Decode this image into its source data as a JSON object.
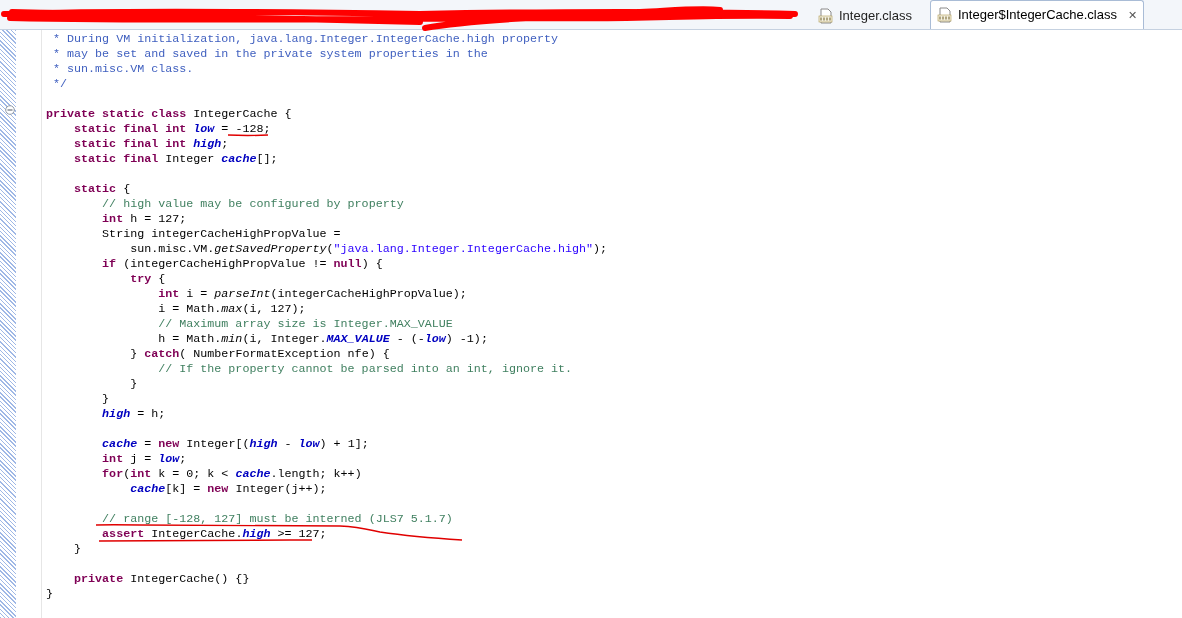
{
  "tabs": [
    {
      "label": "Integer.class",
      "selected": false
    },
    {
      "label": "Integer$IntegerCache.class",
      "selected": true
    }
  ],
  "close_glyph": "✕",
  "editor": {
    "lines": [
      {
        "tokens": [
          {
            "kind": "doc",
            "text": " * During VM initialization, java.lang.Integer.IntegerCache.high property"
          }
        ]
      },
      {
        "tokens": [
          {
            "kind": "doc",
            "text": " * may be set and saved in the private system properties in the"
          }
        ]
      },
      {
        "tokens": [
          {
            "kind": "doc",
            "text": " * sun.misc.VM class."
          }
        ]
      },
      {
        "blank_line_after": true,
        "tokens": [
          {
            "kind": "doc",
            "text": " */"
          }
        ]
      },
      {
        "folded": false,
        "tokens": [
          {
            "kind": "keyword",
            "text": "private static class"
          },
          {
            "kind": "plain",
            "text": " IntegerCache {"
          }
        ]
      },
      {
        "tokens": [
          {
            "kind": "keyword",
            "text": "    static final int "
          },
          {
            "kind": "field",
            "text": "low"
          },
          {
            "kind": "plain",
            "text": " = -128;"
          }
        ]
      },
      {
        "tokens": [
          {
            "kind": "keyword",
            "text": "    static final int "
          },
          {
            "kind": "field",
            "text": "high"
          },
          {
            "kind": "plain",
            "text": ";"
          }
        ]
      },
      {
        "blank_line_after": true,
        "tokens": [
          {
            "kind": "keyword",
            "text": "    static final"
          },
          {
            "kind": "plain",
            "text": " Integer "
          },
          {
            "kind": "field",
            "text": "cache"
          },
          {
            "kind": "plain",
            "text": "[];"
          }
        ]
      },
      {
        "tokens": [
          {
            "kind": "keyword",
            "text": "    static"
          },
          {
            "kind": "plain",
            "text": " {"
          }
        ]
      },
      {
        "tokens": [
          {
            "kind": "comment",
            "text": "        // high value may be configured by property"
          }
        ]
      },
      {
        "tokens": [
          {
            "kind": "keyword",
            "text": "        int"
          },
          {
            "kind": "plain",
            "text": " h = 127;"
          }
        ]
      },
      {
        "tokens": [
          {
            "kind": "plain",
            "text": "        String integerCacheHighPropValue ="
          }
        ]
      },
      {
        "tokens": [
          {
            "kind": "plain",
            "text": "            sun.misc.VM."
          },
          {
            "kind": "static-method",
            "text": "getSavedProperty"
          },
          {
            "kind": "plain",
            "text": "("
          },
          {
            "kind": "string",
            "text": "\"java.lang.Integer.IntegerCache.high\""
          },
          {
            "kind": "plain",
            "text": ");"
          }
        ]
      },
      {
        "tokens": [
          {
            "kind": "keyword",
            "text": "        if"
          },
          {
            "kind": "plain",
            "text": " (integerCacheHighPropValue != "
          },
          {
            "kind": "keyword",
            "text": "null"
          },
          {
            "kind": "plain",
            "text": ") {"
          }
        ]
      },
      {
        "tokens": [
          {
            "kind": "keyword",
            "text": "            try"
          },
          {
            "kind": "plain",
            "text": " {"
          }
        ]
      },
      {
        "tokens": [
          {
            "kind": "keyword",
            "text": "                int"
          },
          {
            "kind": "plain",
            "text": " i = "
          },
          {
            "kind": "static-method",
            "text": "parseInt"
          },
          {
            "kind": "plain",
            "text": "(integerCacheHighPropValue);"
          }
        ]
      },
      {
        "tokens": [
          {
            "kind": "plain",
            "text": "                i = Math."
          },
          {
            "kind": "static-method",
            "text": "max"
          },
          {
            "kind": "plain",
            "text": "(i, 127);"
          }
        ]
      },
      {
        "tokens": [
          {
            "kind": "comment",
            "text": "                // Maximum array size is Integer.MAX_VALUE"
          }
        ]
      },
      {
        "tokens": [
          {
            "kind": "plain",
            "text": "                h = Math."
          },
          {
            "kind": "static-method",
            "text": "min"
          },
          {
            "kind": "plain",
            "text": "(i, Integer."
          },
          {
            "kind": "field",
            "text": "MAX_VALUE"
          },
          {
            "kind": "plain",
            "text": " - (-"
          },
          {
            "kind": "field",
            "text": "low"
          },
          {
            "kind": "plain",
            "text": ") -1);"
          }
        ]
      },
      {
        "tokens": [
          {
            "kind": "plain",
            "text": "            } "
          },
          {
            "kind": "keyword",
            "text": "catch"
          },
          {
            "kind": "plain",
            "text": "( NumberFormatException nfe) {"
          }
        ]
      },
      {
        "tokens": [
          {
            "kind": "comment",
            "text": "                // If the property cannot be parsed into an int, ignore it."
          }
        ]
      },
      {
        "tokens": [
          {
            "kind": "plain",
            "text": "            }"
          }
        ]
      },
      {
        "tokens": [
          {
            "kind": "plain",
            "text": "        }"
          }
        ]
      },
      {
        "blank_line_after": true,
        "tokens": [
          {
            "kind": "field",
            "text": "        high"
          },
          {
            "kind": "plain",
            "text": " = h;"
          }
        ]
      },
      {
        "tokens": [
          {
            "kind": "field",
            "text": "        cache"
          },
          {
            "kind": "plain",
            "text": " = "
          },
          {
            "kind": "keyword",
            "text": "new"
          },
          {
            "kind": "plain",
            "text": " Integer[("
          },
          {
            "kind": "field",
            "text": "high"
          },
          {
            "kind": "plain",
            "text": " - "
          },
          {
            "kind": "field",
            "text": "low"
          },
          {
            "kind": "plain",
            "text": ") + 1];"
          }
        ]
      },
      {
        "tokens": [
          {
            "kind": "keyword",
            "text": "        int"
          },
          {
            "kind": "plain",
            "text": " j = "
          },
          {
            "kind": "field",
            "text": "low"
          },
          {
            "kind": "plain",
            "text": ";"
          }
        ]
      },
      {
        "tokens": [
          {
            "kind": "keyword",
            "text": "        for"
          },
          {
            "kind": "plain",
            "text": "("
          },
          {
            "kind": "keyword",
            "text": "int"
          },
          {
            "kind": "plain",
            "text": " k = 0; k < "
          },
          {
            "kind": "field",
            "text": "cache"
          },
          {
            "kind": "plain",
            "text": ".length; k++)"
          }
        ]
      },
      {
        "blank_line_after": true,
        "tokens": [
          {
            "kind": "field",
            "text": "            cache"
          },
          {
            "kind": "plain",
            "text": "[k] = "
          },
          {
            "kind": "keyword",
            "text": "new"
          },
          {
            "kind": "plain",
            "text": " Integer(j++);"
          }
        ]
      },
      {
        "tokens": [
          {
            "kind": "comment",
            "text": "        // range [-128, 127] must be interned (JLS7 5.1.7)"
          }
        ]
      },
      {
        "tokens": [
          {
            "kind": "keyword",
            "text": "        assert"
          },
          {
            "kind": "plain",
            "text": " IntegerCache."
          },
          {
            "kind": "field",
            "text": "high"
          },
          {
            "kind": "plain",
            "text": " >= 127;"
          }
        ]
      },
      {
        "blank_line_after": true,
        "tokens": [
          {
            "kind": "plain",
            "text": "    }"
          }
        ]
      },
      {
        "tokens": [
          {
            "kind": "keyword",
            "text": "    private"
          },
          {
            "kind": "plain",
            "text": " IntegerCache() {}"
          }
        ]
      },
      {
        "tokens": [
          {
            "kind": "plain",
            "text": "}"
          }
        ]
      }
    ]
  }
}
